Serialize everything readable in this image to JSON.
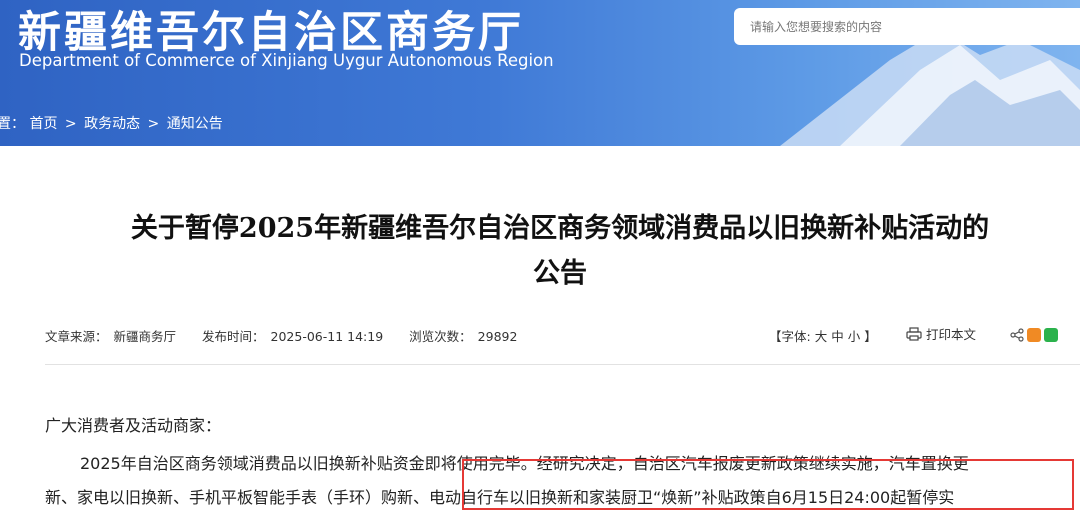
{
  "header": {
    "site_title": "新疆维吾尔自治区商务厅",
    "site_subtitle": "Department of Commerce of Xinjiang Uygur Autonomous Region",
    "search_placeholder": "请输入您想要搜索的内容"
  },
  "breadcrumb": {
    "prefix": "置：",
    "items": [
      "首页",
      "政务动态",
      "通知公告"
    ],
    "separator": ">"
  },
  "article": {
    "title_line1": "关于暂停2025年新疆维吾尔自治区商务领域消费品以旧换新补贴活动的",
    "title_line2": "公告",
    "source_label": "文章来源：",
    "source_value": "新疆商务厅",
    "date_label": "发布时间：",
    "date_value": "2025-06-11 14:19",
    "views_label": "浏览次数：",
    "views_value": "29892",
    "font_size_label": "【字体:",
    "font_large": "大",
    "font_medium": "中",
    "font_small": "小",
    "font_size_end": "】",
    "print_label": "打印本文",
    "greeting": "广大消费者及活动商家：",
    "para1": "2025年自治区商务领域消费品以旧换新补贴资金即将使用完毕。经研究决定，自治区汽车报废更新政策继续实施，汽车置换更",
    "para2": "新、家电以旧换新、手机平板智能手表（手环）购新、电动自行车以旧换新和家装厨卫“焕新”补贴政策自6月15日24:00起暂停实"
  },
  "colors": {
    "header_blue": "#2f63c3",
    "highlight_red": "#e53935",
    "weibo_orange": "#f08a24",
    "wechat_green": "#2bb24c"
  }
}
